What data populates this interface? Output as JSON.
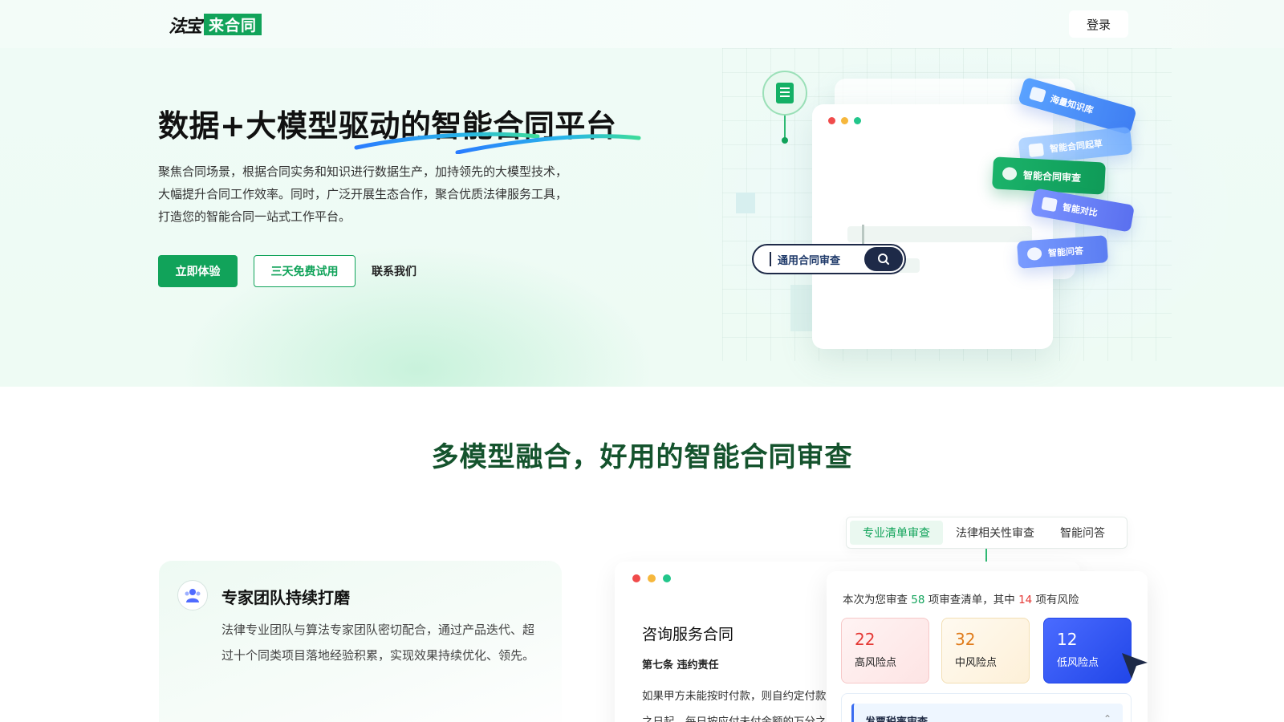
{
  "header": {
    "logo_script": "法宝",
    "logo_box": "来合同",
    "login": "登录"
  },
  "hero": {
    "title": "数据+大模型驱动的智能合同平台",
    "description": "聚焦合同场景，根据合同实务和知识进行数据生产，加持领先的大模型技术，大幅提升合同工作效率。同时，广泛开展生态合作，聚合优质法律服务工具，打造您的智能合同一站式工作平台。",
    "btn_primary": "立即体验",
    "btn_outline": "三天免费试用",
    "btn_contact": "联系我们",
    "search_text": "通用合同审查",
    "chips": [
      "海量知识库",
      "智能合同起草",
      "智能合同审查",
      "智能对比",
      "智能问答"
    ]
  },
  "section2": {
    "title": "多模型融合，好用的智能合同审查",
    "feature": {
      "title": "专家团队持续打磨",
      "desc": "法律专业团队与算法专家团队密切配合，通过产品迭代、超过十个同类项目落地经验积累，实现效果持续优化、领先。"
    },
    "tabs": [
      "专业清单审查",
      "法律相关性审查",
      "智能问答"
    ],
    "doc": {
      "title": "咨询服务合同",
      "sub": "第七条  违约责任",
      "line1": "如果甲方未能按时付款，则自约定付款",
      "line2": "之日起，每日按应付未付金额的万分之"
    },
    "risk": {
      "summary_pre": "本次为您审查 ",
      "total": "58",
      "summary_mid": " 项审查清单，其中 ",
      "risky": "14",
      "summary_post": " 项有风险",
      "high_num": "22",
      "high_lbl": "高风险点",
      "mid_num": "32",
      "mid_lbl": "中风险点",
      "low_num": "12",
      "low_lbl": "低风险点",
      "invoice": "发票税率审查"
    }
  },
  "colors": {
    "brand": "#11a35a",
    "title_green": "#14532d",
    "high": "#e53935",
    "mid": "#e07b1a",
    "low": "#2146e8"
  }
}
